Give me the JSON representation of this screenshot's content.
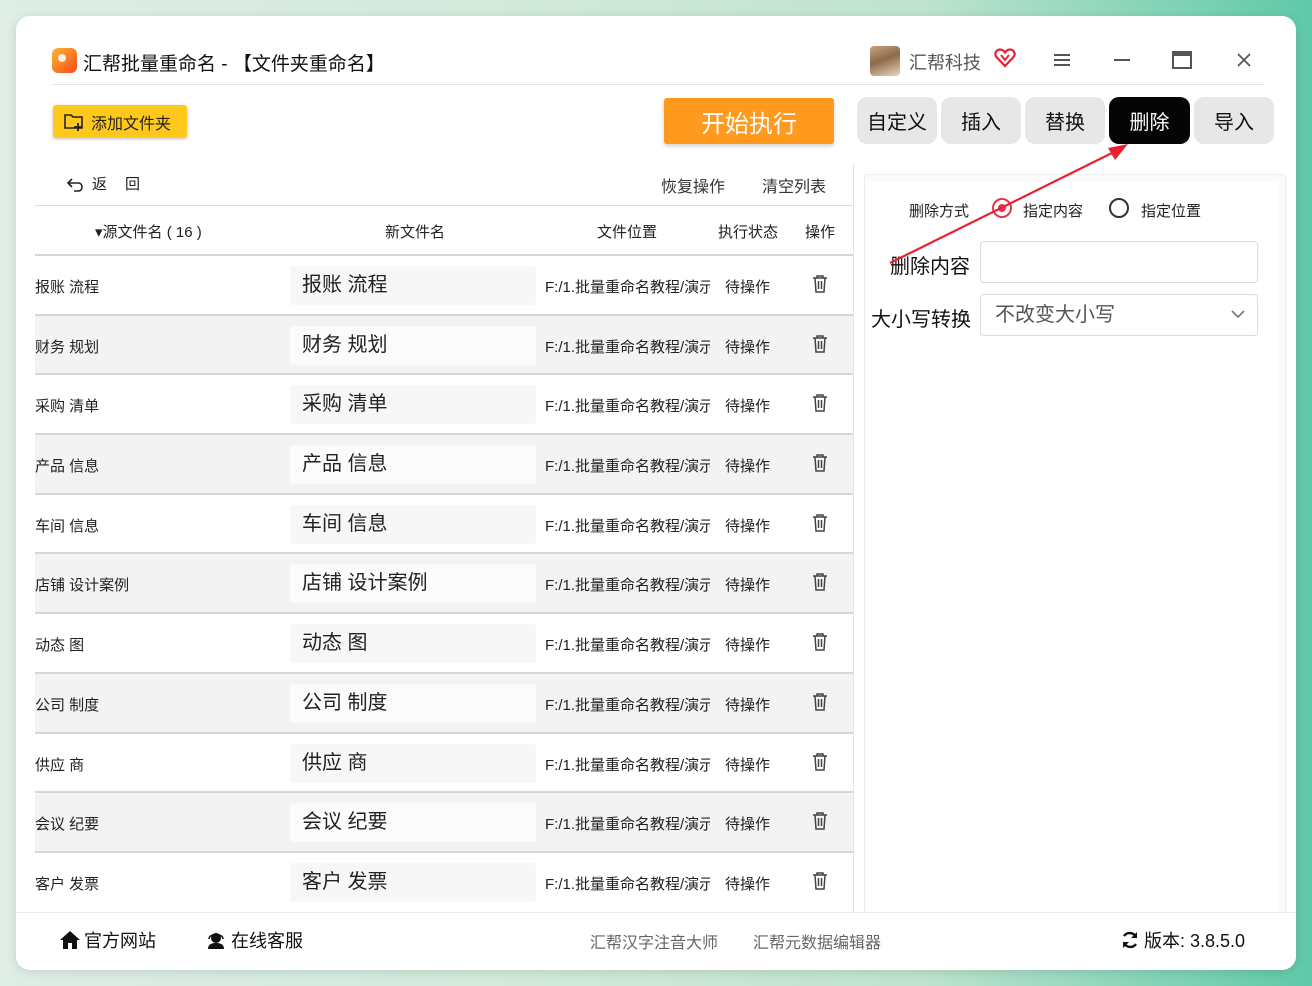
{
  "window": {
    "title": "汇帮批量重命名 - 【文件夹重命名】",
    "company": "汇帮科技",
    "controls": {
      "menu": "≡",
      "minimize": "—",
      "maximize": "▭",
      "close": "✕"
    }
  },
  "toolbar": {
    "add_folder": "添加文件夹",
    "start": "开始执行"
  },
  "tabs": [
    {
      "label": "自定义",
      "active": false
    },
    {
      "label": "插入",
      "active": false
    },
    {
      "label": "替换",
      "active": false
    },
    {
      "label": "删除",
      "active": true
    },
    {
      "label": "导入",
      "active": false
    }
  ],
  "list_actions": {
    "undo": "返回",
    "restore": "恢复操作",
    "clear": "清空列表"
  },
  "table": {
    "headers": {
      "source": "▾源文件名 ( 16 )",
      "new_name": "新文件名",
      "location": "文件位置",
      "status": "执行状态",
      "action": "操作"
    },
    "rows": [
      {
        "source": "报账  流程",
        "new_name": "报账  流程",
        "location": "F:/1.批量重命名教程/演示",
        "status": "待操作"
      },
      {
        "source": "财务  规划",
        "new_name": "财务  规划",
        "location": "F:/1.批量重命名教程/演示",
        "status": "待操作"
      },
      {
        "source": "采购  清单",
        "new_name": "采购  清单",
        "location": "F:/1.批量重命名教程/演示",
        "status": "待操作"
      },
      {
        "source": "产品  信息",
        "new_name": "产品  信息",
        "location": "F:/1.批量重命名教程/演示",
        "status": "待操作"
      },
      {
        "source": "车间  信息",
        "new_name": "车间  信息",
        "location": "F:/1.批量重命名教程/演示",
        "status": "待操作"
      },
      {
        "source": "店铺  设计案例",
        "new_name": "店铺  设计案例",
        "location": "F:/1.批量重命名教程/演示",
        "status": "待操作"
      },
      {
        "source": "动态  图",
        "new_name": "动态  图",
        "location": "F:/1.批量重命名教程/演示",
        "status": "待操作"
      },
      {
        "source": "公司  制度",
        "new_name": "公司  制度",
        "location": "F:/1.批量重命名教程/演示",
        "status": "待操作"
      },
      {
        "source": "供应  商",
        "new_name": "供应  商",
        "location": "F:/1.批量重命名教程/演示",
        "status": "待操作"
      },
      {
        "source": "会议  纪要",
        "new_name": "会议  纪要",
        "location": "F:/1.批量重命名教程/演示",
        "status": "待操作"
      },
      {
        "source": "客户  发票",
        "new_name": "客户  发票",
        "location": "F:/1.批量重命名教程/演示",
        "status": "待操作"
      }
    ]
  },
  "delete_panel": {
    "mode_label": "删除方式",
    "mode_options": [
      {
        "label": "指定内容",
        "selected": true
      },
      {
        "label": "指定位置",
        "selected": false
      }
    ],
    "content_label": "删除内容",
    "content_value": "",
    "case_label": "大小写转换",
    "case_value": "不改变大小写"
  },
  "footer": {
    "website": "官方网站",
    "support": "在线客服",
    "link1": "汇帮汉字注音大师",
    "link2": "汇帮元数据编辑器",
    "version": "版本:  3.8.5.0"
  },
  "colors": {
    "start_button": "#ff9a1f",
    "add_button": "#ffc81a",
    "active_tab": "#050505",
    "radio_selected": "#e8344a",
    "annotation_arrow": "#e8202f"
  },
  "icons": [
    "app-logo-icon",
    "avatar",
    "vip-heart-icon",
    "menu-icon",
    "minimize-icon",
    "maximize-icon",
    "close-icon",
    "add-folder-icon",
    "undo-icon",
    "sort-down-icon",
    "trash-icon",
    "home-icon",
    "headset-icon",
    "refresh-icon",
    "chevron-down-icon"
  ]
}
